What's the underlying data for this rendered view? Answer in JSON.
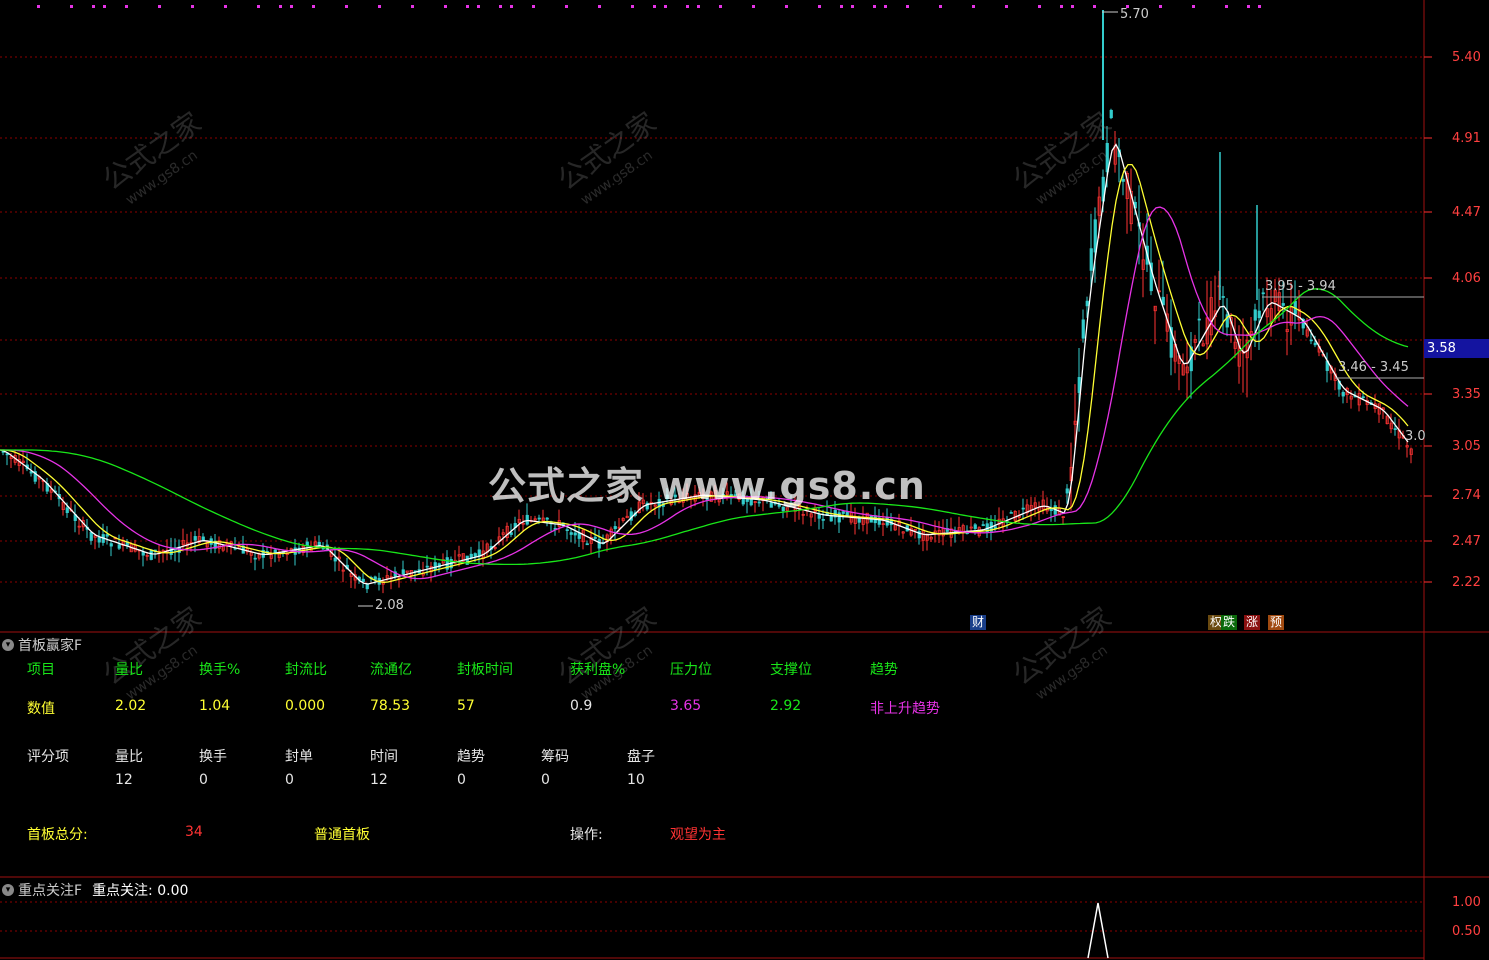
{
  "main_chart": {
    "y_axis_ticks": [
      "5.40",
      "4.91",
      "4.47",
      "4.06",
      "3.35",
      "3.05",
      "2.74",
      "2.47",
      "2.22"
    ],
    "current_price_tag": "3.58",
    "annotations": {
      "high": "5.70",
      "low": "2.08",
      "range_upper": "3.95 - 3.94",
      "range_lower": "3.46 - 3.45",
      "last": "3.0"
    },
    "event_badges": [
      "财",
      "权",
      "跌",
      "涨",
      "预"
    ],
    "watermark_main": "公式之家 www.gs8.cn",
    "watermark_repeat": "公式之家",
    "watermark_url": "www.gs8.cn",
    "colors": {
      "up": "#ff3333",
      "down": "#33cccc",
      "ma5": "#ffffff",
      "ma10": "#ffff33",
      "ma20": "#e633e6",
      "ma60": "#19e619",
      "grid": "#8b0000"
    }
  },
  "panel1": {
    "title": "首板赢家F",
    "row1_header": [
      "项目",
      "量比",
      "换手%",
      "封流比",
      "流通亿",
      "封板时间",
      "获利盘%",
      "压力位",
      "支撑位",
      "趋势"
    ],
    "row1_values": [
      "数值",
      "2.02",
      "1.04",
      "0.000",
      "78.53",
      "57",
      "0.9",
      "3.65",
      "2.92",
      "非上升趋势"
    ],
    "row2_header": [
      "评分项",
      "量比",
      "换手",
      "封单",
      "时间",
      "趋势",
      "筹码",
      "盘子"
    ],
    "row2_values": [
      "12",
      "0",
      "0",
      "12",
      "0",
      "0",
      "10"
    ],
    "summary": {
      "total_label": "首板总分:",
      "total_value": "34",
      "type": "普通首板",
      "op_label": "操作:",
      "op_value": "观望为主"
    }
  },
  "panel2": {
    "title": "重点关注F",
    "value_label": "重点关注: 0.00",
    "y_axis_ticks": [
      "1.00",
      "0.50"
    ]
  }
}
